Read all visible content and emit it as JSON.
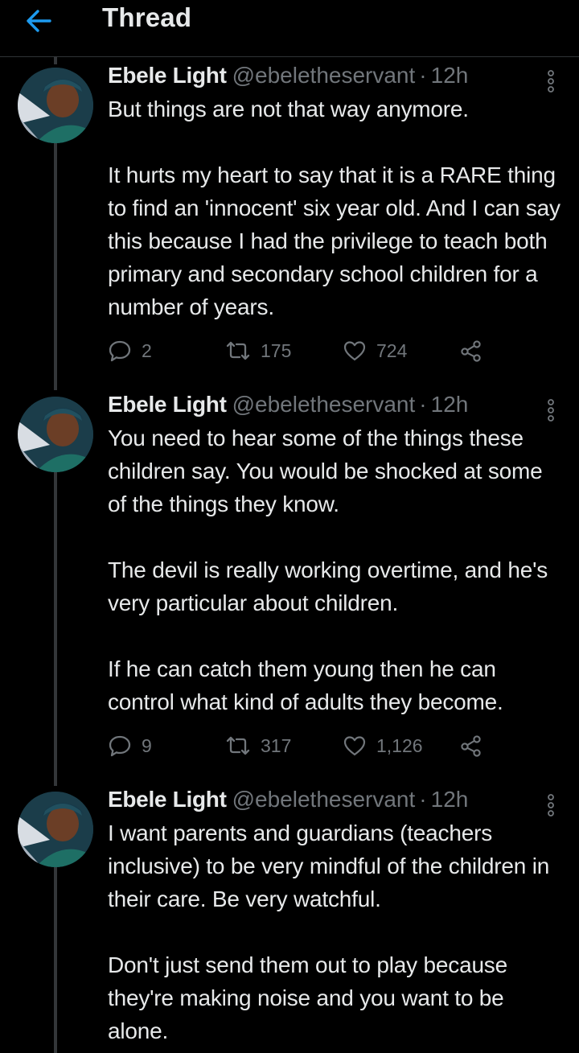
{
  "header": {
    "title": "Thread",
    "accent_color": "#1d9bf0"
  },
  "tweets": [
    {
      "author_name": "Ebele Light",
      "handle": "@ebeletheservant",
      "separator": "·",
      "time": "12h",
      "text": "But things are not that way anymore.\n\nIt hurts my heart to say that it is a RARE thing to find an 'innocent' six year old. And I can say this because I had the privilege to teach both primary and secondary school children for a number of years.",
      "replies": "2",
      "retweets": "175",
      "likes": "724"
    },
    {
      "author_name": "Ebele Light",
      "handle": "@ebeletheservant",
      "separator": "·",
      "time": "12h",
      "text": "You need to hear some of the things these children say. You would be shocked at some of the things they know.\n\nThe devil is really working overtime, and he's very particular about children.\n\nIf he can catch them young then he can control what kind of adults they become.",
      "replies": "9",
      "retweets": "317",
      "likes": "1,126"
    },
    {
      "author_name": "Ebele Light",
      "handle": "@ebeletheservant",
      "separator": "·",
      "time": "12h",
      "text": "I want parents and guardians (teachers inclusive) to be very mindful of the children in their care. Be very watchful.\n\nDon't just send them out to play because they're making noise and you want to be alone."
    }
  ],
  "icons": {
    "back": "back-arrow-icon",
    "more": "more-vertical-icon",
    "reply": "reply-icon",
    "retweet": "retweet-icon",
    "like": "heart-icon",
    "share": "share-icon"
  }
}
